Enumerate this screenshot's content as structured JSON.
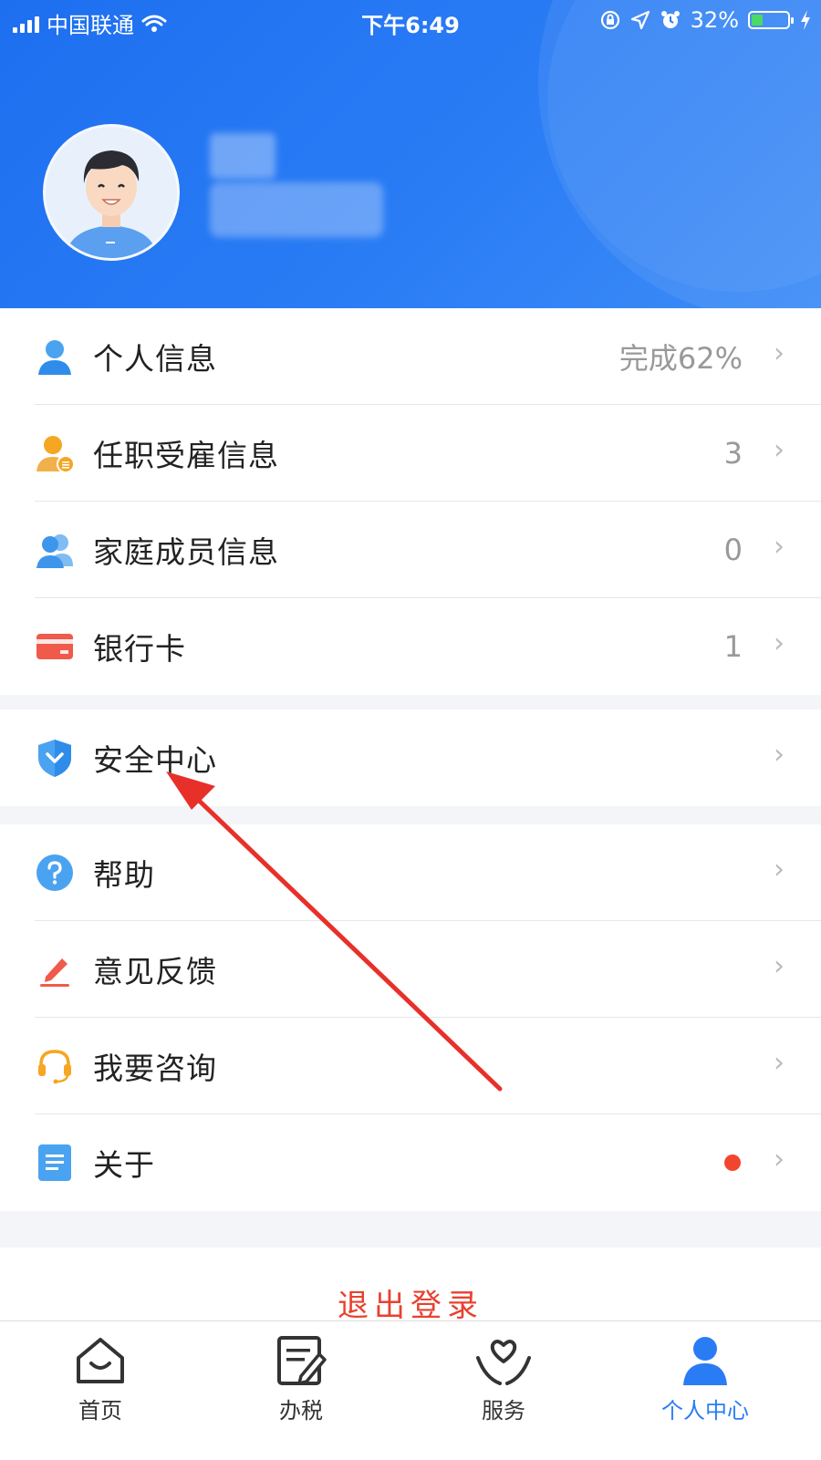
{
  "status_bar": {
    "carrier": "中国联通",
    "time": "下午6:49",
    "battery_percent": "32%",
    "battery_level": 0.32
  },
  "profile": {
    "avatar": "avatar-icon"
  },
  "menu_group1": [
    {
      "label": "个人信息",
      "value": "完成62%",
      "icon": "person-icon"
    },
    {
      "label": "任职受雇信息",
      "value": "3",
      "icon": "employment-icon"
    },
    {
      "label": "家庭成员信息",
      "value": "0",
      "icon": "family-icon"
    },
    {
      "label": "银行卡",
      "value": "1",
      "icon": "bank-card-icon"
    }
  ],
  "menu_group2": [
    {
      "label": "安全中心",
      "icon": "shield-icon"
    }
  ],
  "menu_group3": [
    {
      "label": "帮助",
      "icon": "help-icon"
    },
    {
      "label": "意见反馈",
      "icon": "feedback-pen-icon"
    },
    {
      "label": "我要咨询",
      "icon": "headset-icon"
    },
    {
      "label": "关于",
      "icon": "document-icon",
      "badge": "red-dot"
    }
  ],
  "logout_label": "退出登录",
  "tabbar": [
    {
      "label": "首页",
      "icon": "home-icon"
    },
    {
      "label": "办税",
      "icon": "tax-edit-icon"
    },
    {
      "label": "服务",
      "icon": "service-heart-icon"
    },
    {
      "label": "个人中心",
      "icon": "personal-center-icon",
      "active": true
    }
  ],
  "colors": {
    "header_blue": "#1d6ff0",
    "accent": "#2a7cf5",
    "logout_red": "#e8412f",
    "badge_red": "#f2452f",
    "annotation_arrow": "#e8302a"
  }
}
